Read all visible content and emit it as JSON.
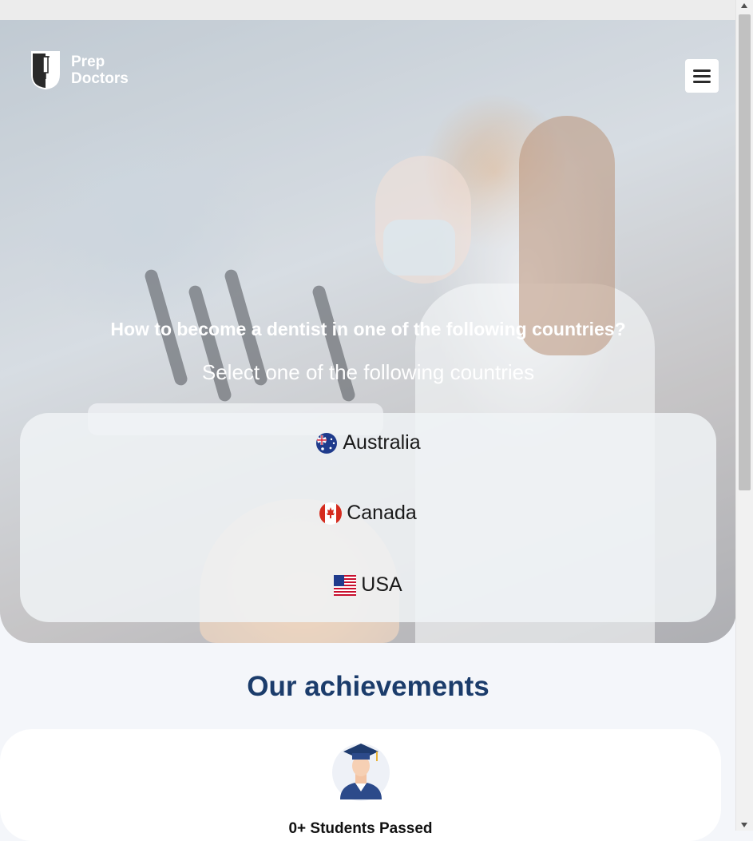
{
  "brand": {
    "line1": "Prep",
    "line2": "Doctors"
  },
  "hero": {
    "title": "How to become a dentist in one of the following countries?",
    "subtitle": "Select one of the following countries"
  },
  "countries": [
    {
      "label": "Australia",
      "flag": "australia-flag-icon"
    },
    {
      "label": "Canada",
      "flag": "canada-flag-icon"
    },
    {
      "label": "USA",
      "flag": "usa-flag-icon"
    }
  ],
  "achievements": {
    "title": "Our achievements",
    "stat_value": "0+",
    "stat_label": "Students Passed"
  },
  "colors": {
    "heading": "#1b3c6b",
    "card": "#ffffff",
    "page_bg": "#f4f6fa"
  }
}
